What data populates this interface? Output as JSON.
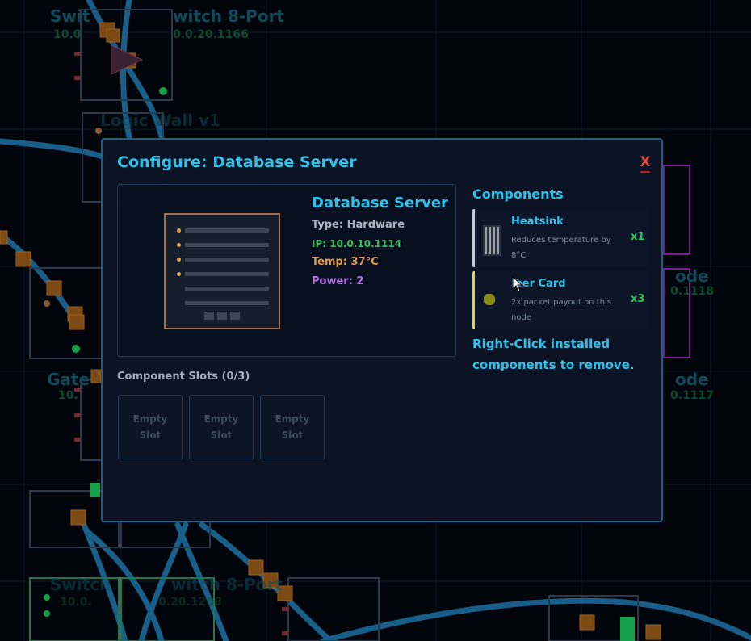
{
  "background": {
    "labels": [
      {
        "text": "Swit",
        "kind": "name"
      },
      {
        "text": "witch 8-Port",
        "kind": "name"
      },
      {
        "text": "10.0",
        "kind": "ip"
      },
      {
        "text": "0.0.20.1166",
        "kind": "ip"
      },
      {
        "text": "Logic Wall v1",
        "kind": "name"
      },
      {
        "text": "ode",
        "kind": "name"
      },
      {
        "text": "0.1118",
        "kind": "ip"
      },
      {
        "text": "Gate",
        "kind": "name"
      },
      {
        "text": "10.",
        "kind": "ip"
      },
      {
        "text": "ode",
        "kind": "name"
      },
      {
        "text": "0.1117",
        "kind": "ip"
      },
      {
        "text": "Switch",
        "kind": "name"
      },
      {
        "text": "witch 8-Port",
        "kind": "name"
      },
      {
        "text": "10.0.",
        "kind": "ip"
      },
      {
        "text": "0.20.1208",
        "kind": "ip"
      }
    ]
  },
  "modal": {
    "title": "Configure: Database Server",
    "close_label": "X",
    "device": {
      "name": "Database Server",
      "type": "Type: Hardware",
      "ip": "IP: 10.0.10.1114",
      "temp": "Temp: 37°C",
      "power": "Power: 2",
      "image_icon": "server-rack-icon"
    },
    "slots": {
      "label": "Component Slots (0/3)",
      "items": [
        {
          "label": "Empty Slot"
        },
        {
          "label": "Empty Slot"
        },
        {
          "label": "Empty Slot"
        }
      ]
    },
    "components": {
      "title": "Components",
      "items": [
        {
          "name": "Heatsink",
          "description": "Reduces temperature by 8°C",
          "count": "x1",
          "icon": "heatsink-icon",
          "accent": "#c9ccd4"
        },
        {
          "name": "iber Card",
          "description": "2x packet payout on this node",
          "count": "x3",
          "icon": "fiber-card-icon",
          "accent": "#e8d422"
        }
      ],
      "hint": "Right-Click installed components to remove."
    }
  },
  "colors": {
    "accent": "#2bc3ea",
    "close": "#e2453c",
    "ip": "#31c15a",
    "temp": "#e39a4c",
    "power": "#b877e8",
    "count": "#30c358"
  }
}
